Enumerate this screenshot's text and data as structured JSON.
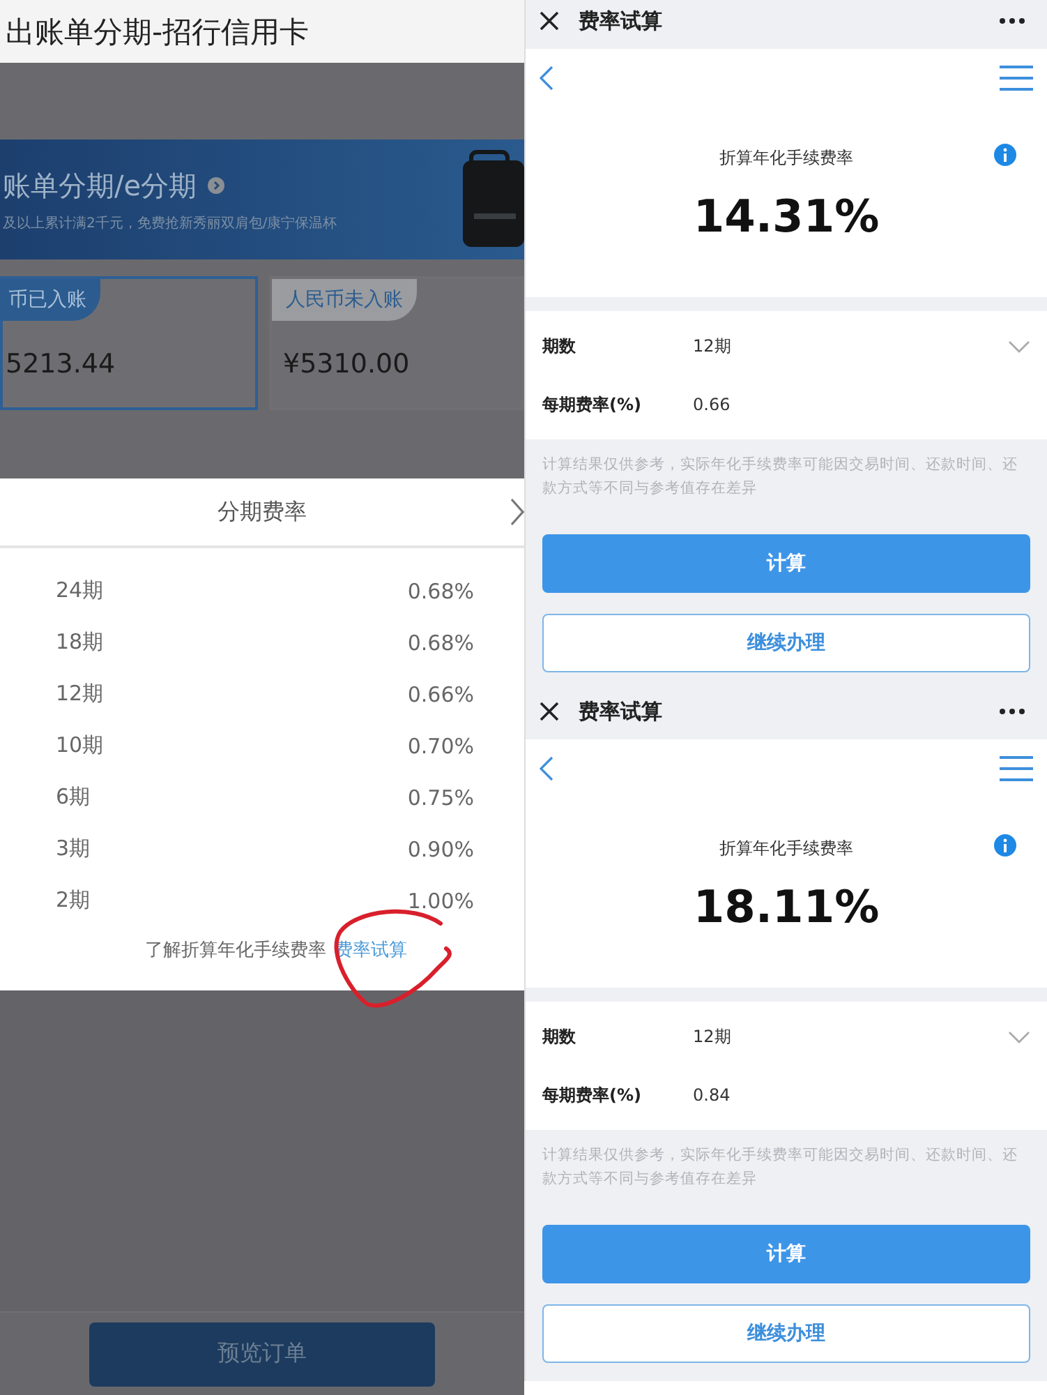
{
  "left": {
    "title": "出账单分期-招行信用卡",
    "banner": {
      "title": "账单分期/e分期",
      "subtitle": "及以上累计满2千元，免费抢新秀丽双肩包/康宁保温杯"
    },
    "tabs": [
      {
        "label": "币已入账",
        "amount": "5213.44",
        "selected": true
      },
      {
        "label": "人民币未入账",
        "amount": "¥5310.00",
        "selected": false
      }
    ],
    "sheet": {
      "title": "分期费率",
      "rows": [
        {
          "term": "24期",
          "rate": "0.68%"
        },
        {
          "term": "18期",
          "rate": "0.68%"
        },
        {
          "term": "12期",
          "rate": "0.66%"
        },
        {
          "term": "10期",
          "rate": "0.70%"
        },
        {
          "term": "6期",
          "rate": "0.75%"
        },
        {
          "term": "3期",
          "rate": "0.90%"
        },
        {
          "term": "2期",
          "rate": "1.00%"
        }
      ],
      "footer_text": "了解折算年化手续费率",
      "footer_link": "费率试算"
    },
    "preview_button": "预览订单"
  },
  "calculators": [
    {
      "title": "费率试算",
      "result_label": "折算年化手续费率",
      "result": "14.31%",
      "fields": [
        {
          "kind": "select",
          "label": "期数",
          "value": "12期"
        },
        {
          "kind": "text",
          "label": "每期费率(%)",
          "value": "0.66"
        }
      ],
      "note": "计算结果仅供参考，实际年化手续费率可能因交易时间、还款时间、还款方式等不同与参考值存在差异",
      "buttons": [
        {
          "kind": "primary",
          "label": "计算"
        },
        {
          "kind": "outline",
          "label": "继续办理"
        }
      ]
    },
    {
      "title": "费率试算",
      "result_label": "折算年化手续费率",
      "result": "18.11%",
      "fields": [
        {
          "kind": "select",
          "label": "期数",
          "value": "12期"
        },
        {
          "kind": "text",
          "label": "每期费率(%)",
          "value": "0.84"
        }
      ],
      "note": "计算结果仅供参考，实际年化手续费率可能因交易时间、还款时间、还款方式等不同与参考值存在差异",
      "buttons": [
        {
          "kind": "primary",
          "label": "计算"
        },
        {
          "kind": "outline",
          "label": "继续办理"
        }
      ]
    }
  ]
}
